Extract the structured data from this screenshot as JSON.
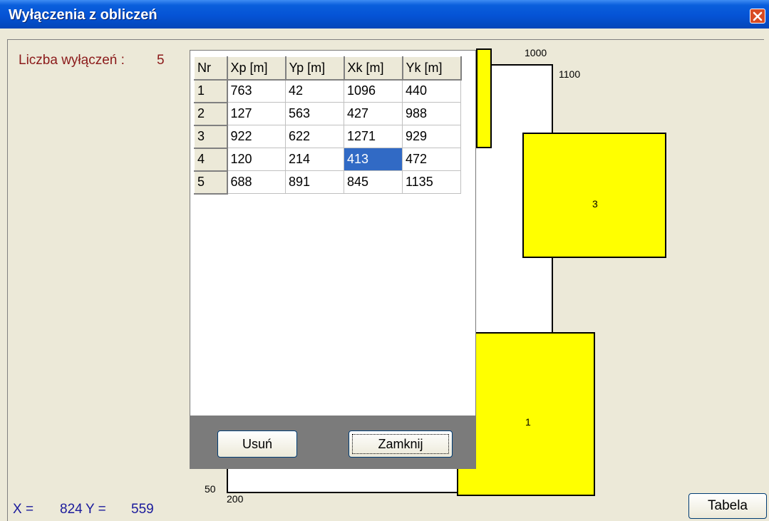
{
  "window": {
    "title": "Wyłączenia z obliczeń"
  },
  "status": {
    "count_label": "Liczba wyłączeń :",
    "count_value": "5",
    "x_label": "X =",
    "x_value": "824",
    "y_label": "Y =",
    "y_value": "559"
  },
  "plan": {
    "label_1000": "1000",
    "label_1100": "1100",
    "label_50": "50",
    "label_200": "200",
    "rect_1_label": "1",
    "rect_3_label": "3"
  },
  "table": {
    "headers": [
      "Nr",
      "Xp [m]",
      "Yp [m]",
      "Xk [m]",
      "Yk [m]"
    ],
    "rows": [
      [
        "1",
        "763",
        "42",
        "1096",
        "440"
      ],
      [
        "2",
        "127",
        "563",
        "427",
        "988"
      ],
      [
        "3",
        "922",
        "622",
        "1271",
        "929"
      ],
      [
        "4",
        "120",
        "214",
        "413",
        "472"
      ],
      [
        "5",
        "688",
        "891",
        "845",
        "1135"
      ]
    ]
  },
  "buttons": {
    "delete": "Usuń",
    "close": "Zamknij",
    "table": "Tabela"
  },
  "colors": {
    "title_bar": "#0553d5",
    "highlight": "#ffff00",
    "selection": "#316ac5",
    "count_text": "#8b1a1a",
    "coord_text": "#1a1a9c"
  }
}
